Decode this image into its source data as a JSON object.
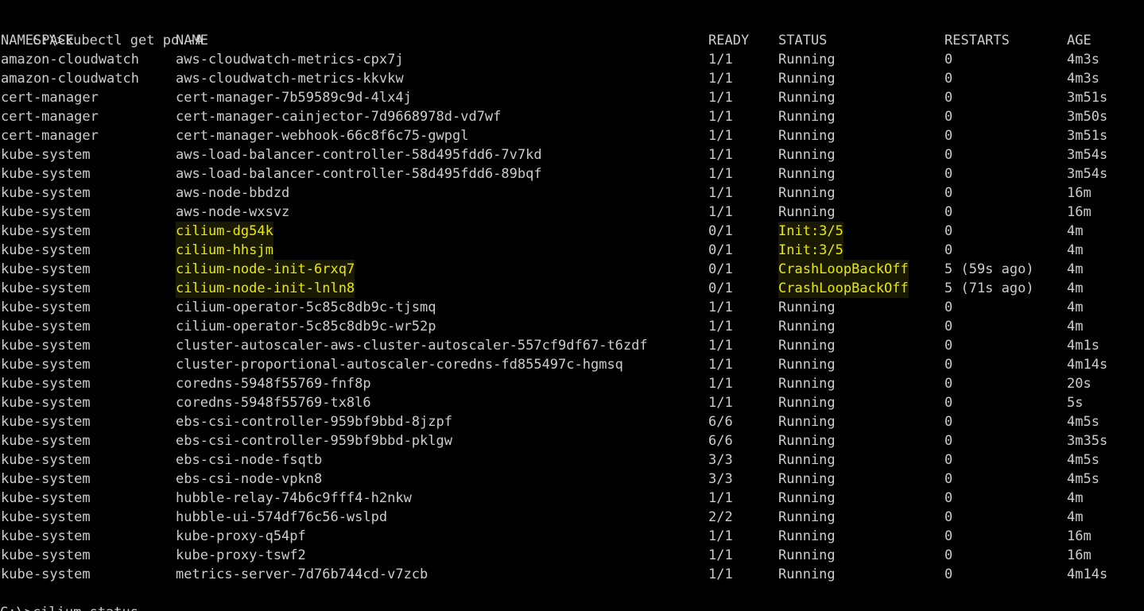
{
  "prompt": "C:\\>",
  "command": "kubectl get po -A",
  "next_line": "C:\\>cilium status",
  "highlight_color": "#e8e800",
  "text_color": "#cccccc",
  "background_color": "#000000",
  "headers": {
    "namespace": "NAMESPACE",
    "name": "NAME",
    "ready": "READY",
    "status": "STATUS",
    "restarts": "RESTARTS",
    "age": "AGE"
  },
  "pods": [
    {
      "namespace": "amazon-cloudwatch",
      "name": "aws-cloudwatch-metrics-cpx7j",
      "ready": "1/1",
      "status": "Running",
      "restarts": "0",
      "age": "4m3s",
      "highlight": false
    },
    {
      "namespace": "amazon-cloudwatch",
      "name": "aws-cloudwatch-metrics-kkvkw",
      "ready": "1/1",
      "status": "Running",
      "restarts": "0",
      "age": "4m3s",
      "highlight": false
    },
    {
      "namespace": "cert-manager",
      "name": "cert-manager-7b59589c9d-4lx4j",
      "ready": "1/1",
      "status": "Running",
      "restarts": "0",
      "age": "3m51s",
      "highlight": false
    },
    {
      "namespace": "cert-manager",
      "name": "cert-manager-cainjector-7d9668978d-vd7wf",
      "ready": "1/1",
      "status": "Running",
      "restarts": "0",
      "age": "3m50s",
      "highlight": false
    },
    {
      "namespace": "cert-manager",
      "name": "cert-manager-webhook-66c8f6c75-gwpgl",
      "ready": "1/1",
      "status": "Running",
      "restarts": "0",
      "age": "3m51s",
      "highlight": false
    },
    {
      "namespace": "kube-system",
      "name": "aws-load-balancer-controller-58d495fdd6-7v7kd",
      "ready": "1/1",
      "status": "Running",
      "restarts": "0",
      "age": "3m54s",
      "highlight": false
    },
    {
      "namespace": "kube-system",
      "name": "aws-load-balancer-controller-58d495fdd6-89bqf",
      "ready": "1/1",
      "status": "Running",
      "restarts": "0",
      "age": "3m54s",
      "highlight": false
    },
    {
      "namespace": "kube-system",
      "name": "aws-node-bbdzd",
      "ready": "1/1",
      "status": "Running",
      "restarts": "0",
      "age": "16m",
      "highlight": false
    },
    {
      "namespace": "kube-system",
      "name": "aws-node-wxsvz",
      "ready": "1/1",
      "status": "Running",
      "restarts": "0",
      "age": "16m",
      "highlight": false
    },
    {
      "namespace": "kube-system",
      "name": "cilium-dg54k",
      "ready": "0/1",
      "status": "Init:3/5",
      "restarts": "0",
      "age": "4m",
      "highlight": true
    },
    {
      "namespace": "kube-system",
      "name": "cilium-hhsjm",
      "ready": "0/1",
      "status": "Init:3/5",
      "restarts": "0",
      "age": "4m",
      "highlight": true
    },
    {
      "namespace": "kube-system",
      "name": "cilium-node-init-6rxq7",
      "ready": "0/1",
      "status": "CrashLoopBackOff",
      "restarts": "5 (59s ago)",
      "age": "4m",
      "highlight": true
    },
    {
      "namespace": "kube-system",
      "name": "cilium-node-init-lnln8",
      "ready": "0/1",
      "status": "CrashLoopBackOff",
      "restarts": "5 (71s ago)",
      "age": "4m",
      "highlight": true
    },
    {
      "namespace": "kube-system",
      "name": "cilium-operator-5c85c8db9c-tjsmq",
      "ready": "1/1",
      "status": "Running",
      "restarts": "0",
      "age": "4m",
      "highlight": false
    },
    {
      "namespace": "kube-system",
      "name": "cilium-operator-5c85c8db9c-wr52p",
      "ready": "1/1",
      "status": "Running",
      "restarts": "0",
      "age": "4m",
      "highlight": false
    },
    {
      "namespace": "kube-system",
      "name": "cluster-autoscaler-aws-cluster-autoscaler-557cf9df67-t6zdf",
      "ready": "1/1",
      "status": "Running",
      "restarts": "0",
      "age": "4m1s",
      "highlight": false
    },
    {
      "namespace": "kube-system",
      "name": "cluster-proportional-autoscaler-coredns-fd855497c-hgmsq",
      "ready": "1/1",
      "status": "Running",
      "restarts": "0",
      "age": "4m14s",
      "highlight": false
    },
    {
      "namespace": "kube-system",
      "name": "coredns-5948f55769-fnf8p",
      "ready": "1/1",
      "status": "Running",
      "restarts": "0",
      "age": "20s",
      "highlight": false
    },
    {
      "namespace": "kube-system",
      "name": "coredns-5948f55769-tx8l6",
      "ready": "1/1",
      "status": "Running",
      "restarts": "0",
      "age": "5s",
      "highlight": false
    },
    {
      "namespace": "kube-system",
      "name": "ebs-csi-controller-959bf9bbd-8jzpf",
      "ready": "6/6",
      "status": "Running",
      "restarts": "0",
      "age": "4m5s",
      "highlight": false
    },
    {
      "namespace": "kube-system",
      "name": "ebs-csi-controller-959bf9bbd-pklgw",
      "ready": "6/6",
      "status": "Running",
      "restarts": "0",
      "age": "3m35s",
      "highlight": false
    },
    {
      "namespace": "kube-system",
      "name": "ebs-csi-node-fsqtb",
      "ready": "3/3",
      "status": "Running",
      "restarts": "0",
      "age": "4m5s",
      "highlight": false
    },
    {
      "namespace": "kube-system",
      "name": "ebs-csi-node-vpkn8",
      "ready": "3/3",
      "status": "Running",
      "restarts": "0",
      "age": "4m5s",
      "highlight": false
    },
    {
      "namespace": "kube-system",
      "name": "hubble-relay-74b6c9fff4-h2nkw",
      "ready": "1/1",
      "status": "Running",
      "restarts": "0",
      "age": "4m",
      "highlight": false
    },
    {
      "namespace": "kube-system",
      "name": "hubble-ui-574df76c56-wslpd",
      "ready": "2/2",
      "status": "Running",
      "restarts": "0",
      "age": "4m",
      "highlight": false
    },
    {
      "namespace": "kube-system",
      "name": "kube-proxy-q54pf",
      "ready": "1/1",
      "status": "Running",
      "restarts": "0",
      "age": "16m",
      "highlight": false
    },
    {
      "namespace": "kube-system",
      "name": "kube-proxy-tswf2",
      "ready": "1/1",
      "status": "Running",
      "restarts": "0",
      "age": "16m",
      "highlight": false
    },
    {
      "namespace": "kube-system",
      "name": "metrics-server-7d76b744cd-v7zcb",
      "ready": "1/1",
      "status": "Running",
      "restarts": "0",
      "age": "4m14s",
      "highlight": false
    }
  ]
}
